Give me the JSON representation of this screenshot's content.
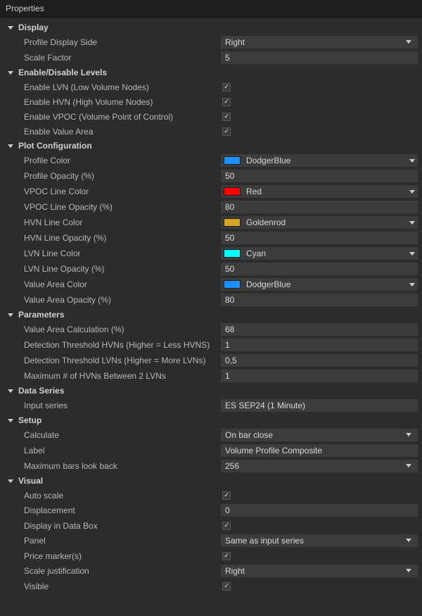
{
  "panel_title": "Properties",
  "colors": {
    "DodgerBlue": "#1e90ff",
    "Red": "#ff0000",
    "Goldenrod": "#daa520",
    "Cyan": "#00ffff"
  },
  "sections": {
    "display": {
      "title": "Display",
      "profile_display_side": {
        "label": "Profile Display Side",
        "value": "Right"
      },
      "scale_factor": {
        "label": "Scale Factor",
        "value": "5"
      }
    },
    "levels": {
      "title": "Enable/Disable Levels",
      "lvn": {
        "label": "Enable LVN (Low Volume Nodes)"
      },
      "hvn": {
        "label": "Enable HVN (High Volume Nodes)"
      },
      "vpoc": {
        "label": "Enable VPOC (Volume Point of Control)"
      },
      "va": {
        "label": "Enable Value Area"
      }
    },
    "plot": {
      "title": "Plot Configuration",
      "profile_color": {
        "label": "Profile Color",
        "value": "DodgerBlue"
      },
      "profile_opacity": {
        "label": "Profile Opacity (%)",
        "value": "50"
      },
      "vpoc_color": {
        "label": "VPOC Line Color",
        "value": "Red"
      },
      "vpoc_opacity": {
        "label": "VPOC Line Opacity (%)",
        "value": "80"
      },
      "hvn_color": {
        "label": "HVN Line Color",
        "value": "Goldenrod"
      },
      "hvn_opacity": {
        "label": "HVN Line Opacity (%)",
        "value": "50"
      },
      "lvn_color": {
        "label": "LVN Line Color",
        "value": "Cyan"
      },
      "lvn_opacity": {
        "label": "LVN Line Opacity (%)",
        "value": "50"
      },
      "va_color": {
        "label": "Value Area Color",
        "value": "DodgerBlue"
      },
      "va_opacity": {
        "label": "Value Area Opacity (%)",
        "value": "80"
      }
    },
    "params": {
      "title": "Parameters",
      "va_calc": {
        "label": "Value Area Calculation (%)",
        "value": "68"
      },
      "hvn_thresh": {
        "label": "Detection Threshold HVNs (Higher = Less HVNS)",
        "value": "1"
      },
      "lvn_thresh": {
        "label": "Detection Threshold LVNs (Higher = More LVNs)",
        "value": "0,5"
      },
      "max_hvn": {
        "label": "Maximum # of HVNs Between 2 LVNs",
        "value": "1"
      }
    },
    "dataseries": {
      "title": "Data Series",
      "input_series": {
        "label": "Input series",
        "value": "ES SEP24 (1 Minute)"
      }
    },
    "setup": {
      "title": "Setup",
      "calculate": {
        "label": "Calculate",
        "value": "On bar close"
      },
      "label_field": {
        "label": "Label",
        "value": "Volume Profile Composite"
      },
      "max_bars": {
        "label": "Maximum bars look back",
        "value": "256"
      }
    },
    "visual": {
      "title": "Visual",
      "auto_scale": {
        "label": "Auto scale"
      },
      "displacement": {
        "label": "Displacement",
        "value": "0"
      },
      "display_databox": {
        "label": "Display in Data Box"
      },
      "panel": {
        "label": "Panel",
        "value": "Same as input series"
      },
      "price_markers": {
        "label": "Price marker(s)"
      },
      "scale_just": {
        "label": "Scale justification",
        "value": "Right"
      },
      "visible": {
        "label": "Visible"
      }
    }
  }
}
